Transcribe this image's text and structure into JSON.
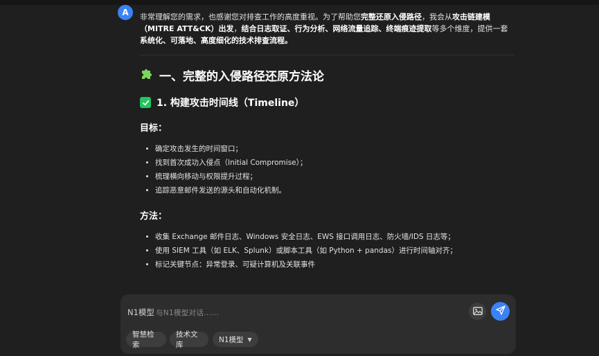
{
  "avatar": {
    "letter": "A"
  },
  "message": {
    "intro": [
      {
        "t": "非常理解您的需求，也感谢您对排查工作的高度重视。为了帮助您",
        "b": false
      },
      {
        "t": "完整还原入侵路径",
        "b": true
      },
      {
        "t": "，我会从",
        "b": false
      },
      {
        "t": "攻击链建模（MITRE ATT&CK）出发",
        "b": true
      },
      {
        "t": "，",
        "b": false
      },
      {
        "t": "结合日志取证、行为分析、网络流量追踪、终端痕迹提取",
        "b": true
      },
      {
        "t": "等多个维度，提供一套",
        "b": false
      },
      {
        "t": "系统化、可落地、高度细化的技术排查流程。",
        "b": true
      }
    ],
    "section_title": "一、完整的入侵路径还原方法论",
    "subsection_title": "1. 构建攻击时间线（Timeline）",
    "goal_heading": "目标：",
    "goals": [
      "确定攻击发生的时间窗口；",
      "找到首次成功入侵点（Initial Compromise）；",
      "梳理横向移动与权限提升过程；",
      "追踪恶意邮件发送的源头和自动化机制。"
    ],
    "method_heading": "方法：",
    "methods": [
      "收集 Exchange 邮件日志、Windows 安全日志、EWS 接口调用日志、防火墙/IDS 日志等；",
      "使用 SIEM 工具（如 ELK、Splunk）或脚本工具（如 Python + pandas）进行时间轴对齐；",
      "标记关键节点：异常登录、可疑计算机及关联事件"
    ]
  },
  "input": {
    "model_label": "N1模型",
    "placeholder": "与N1模型对话......",
    "chips": [
      "智慧检索",
      "技术文库",
      "N1模型"
    ]
  },
  "icons": {
    "section": "puzzle-icon",
    "subsection": "check-box-icon",
    "image_upload": "image-icon",
    "send": "send-icon",
    "dropdown": "caret-down-icon"
  },
  "colors": {
    "background": "#1f1f1f",
    "accent": "#3b82f6",
    "check": "#22c55e",
    "puzzle": "#7fd45b"
  }
}
